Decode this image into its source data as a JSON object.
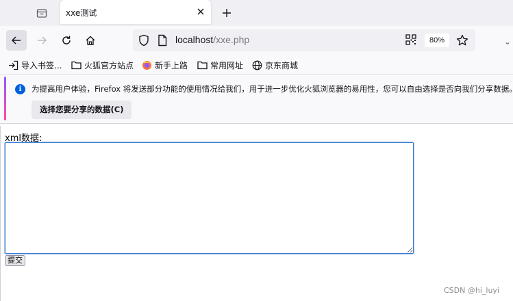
{
  "tab": {
    "title": "xxe测试",
    "close_icon": "close-icon",
    "new_tab_icon": "plus-icon"
  },
  "nav": {
    "url_host": "localhost",
    "url_path": "/xxe.php",
    "zoom": "80%"
  },
  "bookmarks": [
    {
      "label": "导入书签...",
      "icon": "import-icon"
    },
    {
      "label": "火狐官方站点",
      "icon": "folder-icon"
    },
    {
      "label": "新手上路",
      "icon": "firefox-icon"
    },
    {
      "label": "常用网址",
      "icon": "folder-icon"
    },
    {
      "label": "京东商城",
      "icon": "globe-icon"
    }
  ],
  "notification": {
    "text": "为提高用户体验，Firefox 将发送部分功能的使用情况给我们，用于进一步优化火狐浏览器的易用性，您可以自由选择是否向我们分享数据。",
    "button_label": "选择您要分享的数据(C)"
  },
  "form": {
    "label": "xml数据:",
    "textarea_value": "",
    "submit_label": "提交"
  },
  "watermark": "CSDN @hi_luyi",
  "colors": {
    "accent": "#0060df",
    "textarea_border": "#3a7bd5"
  }
}
